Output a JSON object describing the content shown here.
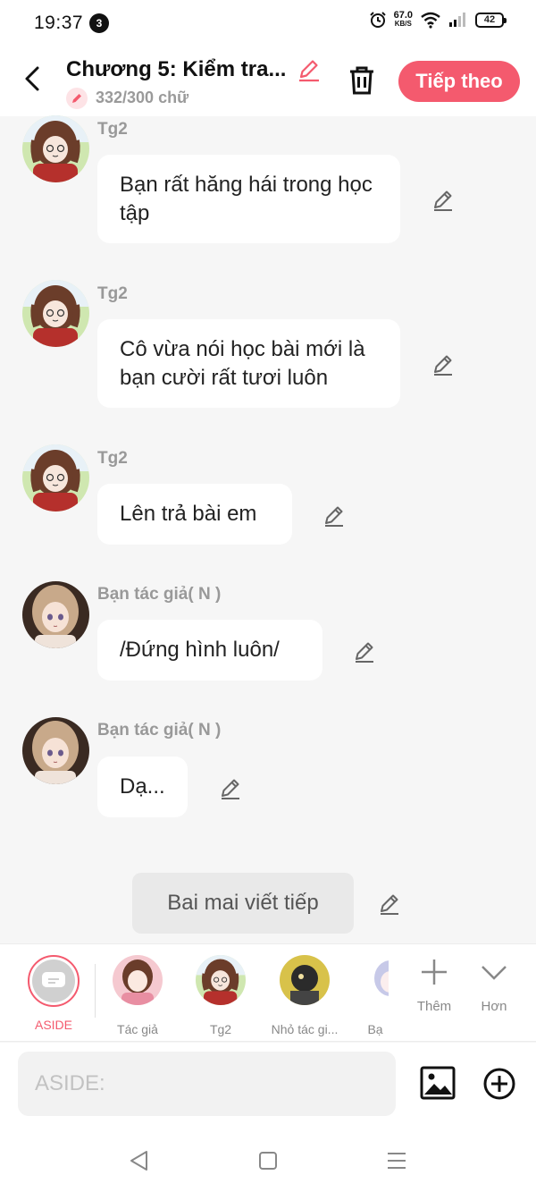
{
  "status_bar": {
    "time": "19:37",
    "notification_count": "3",
    "network_speed": "67.0",
    "network_unit": "KB/S",
    "battery": "42"
  },
  "header": {
    "chapter_title": "Chương 5: Kiểm tra...",
    "word_count": "332/300 chữ",
    "next_label": "Tiếp theo"
  },
  "messages": [
    {
      "speaker": "Tg2",
      "text": "Bạn rất hăng hái trong học tập"
    },
    {
      "speaker": "Tg2",
      "text": "Cô vừa nói học bài mới là bạn cười rất tươi luôn"
    },
    {
      "speaker": "Tg2",
      "text": "Lên trả bài em"
    },
    {
      "speaker": "Bạn tác giả( N )",
      "text": "/Đứng hình luôn/"
    },
    {
      "speaker": "Bạn tác giả( N )",
      "text": "Dạ..."
    }
  ],
  "aside_message": "Bai mai viết tiếp",
  "character_bar": {
    "characters": [
      {
        "label": "ASIDE"
      },
      {
        "label": "Tác giả"
      },
      {
        "label": "Tg2"
      },
      {
        "label": "Nhỏ tác gi..."
      },
      {
        "label": "Bạ"
      }
    ],
    "more_label": "Thêm",
    "collapse_label": "Hơn"
  },
  "composer": {
    "placeholder": "ASIDE:"
  },
  "colors": {
    "accent": "#f45a6e",
    "background": "#f6f6f6",
    "bubble": "#ffffff"
  }
}
